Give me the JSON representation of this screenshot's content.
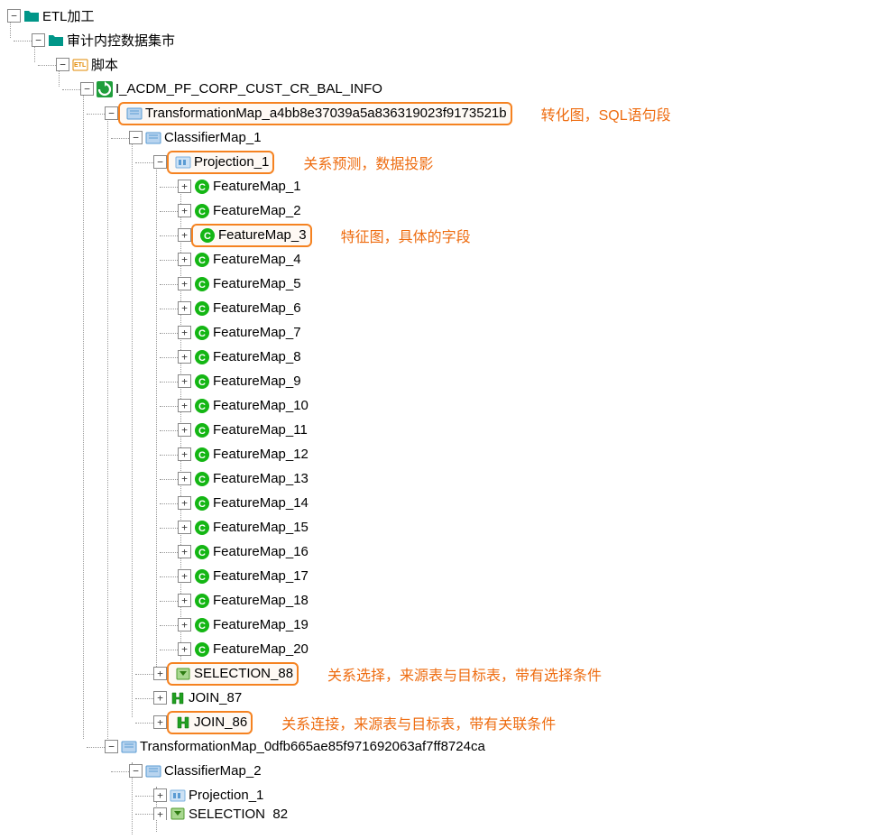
{
  "tree": {
    "root": "ETL加工",
    "level1": "审计内控数据集市",
    "level2": "脚本",
    "level3": "I_ACDM_PF_CORP_CUST_CR_BAL_INFO",
    "tmap1": "TransformationMap_a4bb8e37039a5a836319023f9173521b",
    "cmap1": "ClassifierMap_1",
    "proj1": "Projection_1",
    "features": [
      "FeatureMap_1",
      "FeatureMap_2",
      "FeatureMap_3",
      "FeatureMap_4",
      "FeatureMap_5",
      "FeatureMap_6",
      "FeatureMap_7",
      "FeatureMap_8",
      "FeatureMap_9",
      "FeatureMap_10",
      "FeatureMap_11",
      "FeatureMap_12",
      "FeatureMap_13",
      "FeatureMap_14",
      "FeatureMap_15",
      "FeatureMap_16",
      "FeatureMap_17",
      "FeatureMap_18",
      "FeatureMap_19",
      "FeatureMap_20"
    ],
    "sel88": "SELECTION_88",
    "join87": "JOIN_87",
    "join86": "JOIN_86",
    "tmap2": "TransformationMap_0dfb665ae85f971692063af7ff8724ca",
    "cmap2": "ClassifierMap_2",
    "proj2": "Projection_1",
    "sel82": "SELECTION_82"
  },
  "annotations": {
    "tmap": "转化图，SQL语句段",
    "proj": "关系预测，数据投影",
    "feat": "特征图，具体的字段",
    "sel": "关系选择，来源表与目标表，带有选择条件",
    "join": "关系连接，来源表与目标表，带有关联条件"
  },
  "symbols": {
    "minus": "−",
    "plus": "+"
  }
}
